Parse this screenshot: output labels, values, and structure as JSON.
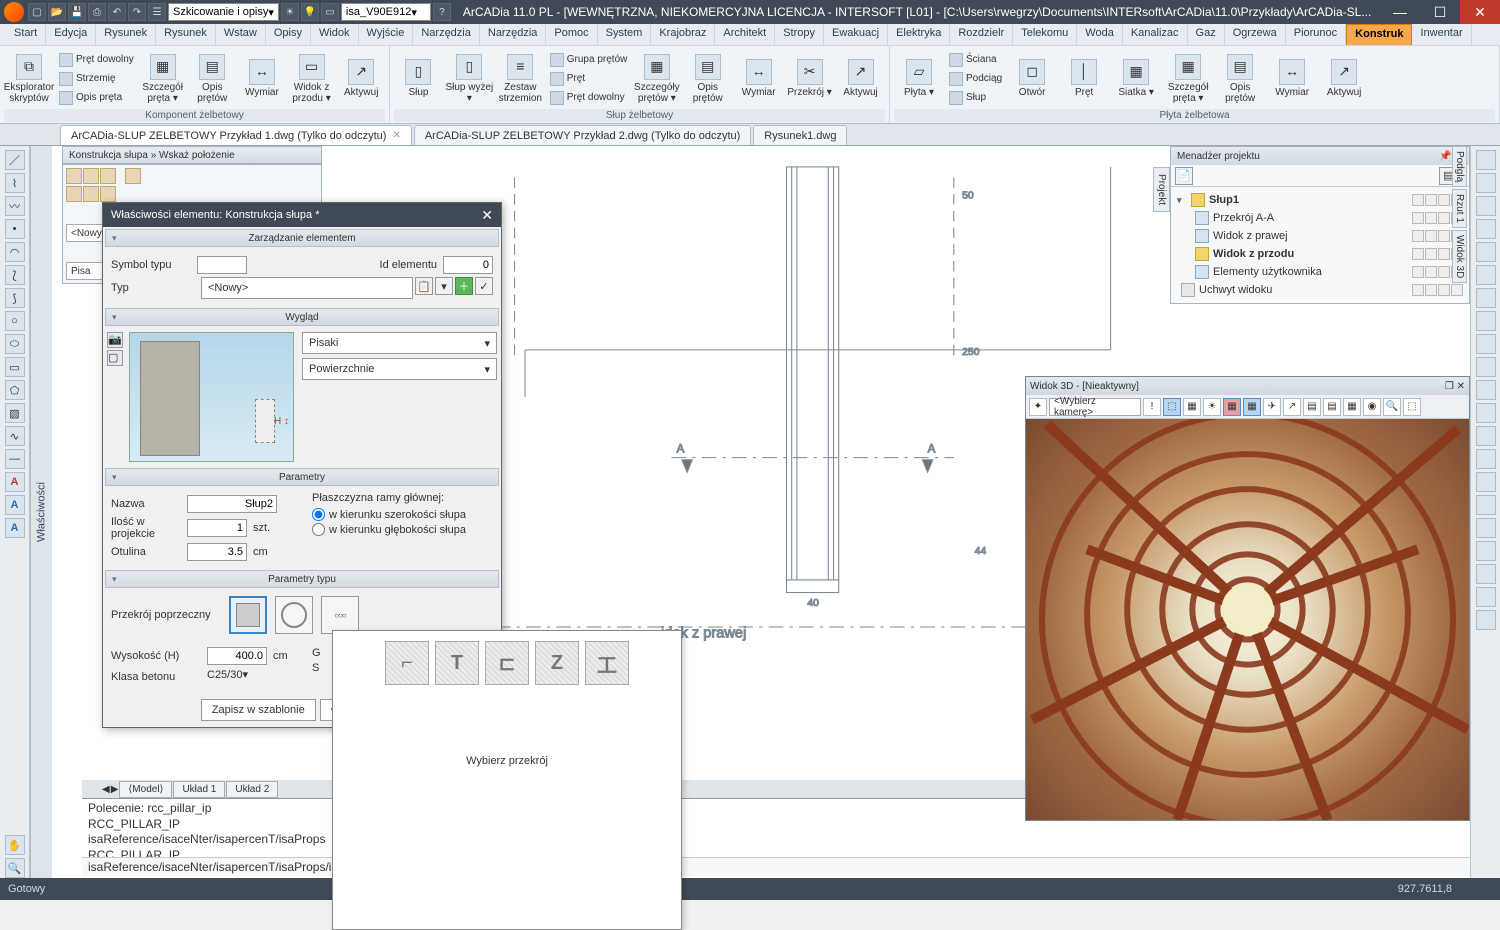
{
  "title": "ArCADia 11.0 PL - [WEWNĘTRZNA, NIEKOMERCYJNA LICENCJA - INTERSOFT [L01] - [C:\\Users\\rwegrzy\\Documents\\INTERsoft\\ArCADia\\11.0\\Przykłady\\ArCADia-SL...",
  "qat_combo1": "Szkicowanie i opisy",
  "qat_combo2": "isa_V90E912",
  "ribbon_tabs": [
    "Start",
    "Edycja",
    "Rysunek",
    "Rysunek",
    "Wstaw",
    "Opisy",
    "Widok",
    "Wyjście",
    "Narzędzia",
    "Narzędzia",
    "Pomoc",
    "System",
    "Krajobraz",
    "Architekt",
    "Stropy",
    "Ewakuacj",
    "Elektryka",
    "Rozdzielr",
    "Telekomu",
    "Woda",
    "Kanalizac",
    "Gaz",
    "Ogrzewa",
    "Piorunoc",
    "Konstruk",
    "Inwentar"
  ],
  "ribbon_active": "Konstruk",
  "panels": {
    "p1": {
      "label": "Komponent żelbetowy",
      "items": [
        "Pręt dowolny",
        "Strzemię",
        "Opis pręta"
      ],
      "big": [
        {
          "l": "Eksplorator\nskryptów"
        },
        {
          "l": "Szczegół\npręta ▾"
        },
        {
          "l": "Opis\nprętów"
        },
        {
          "l": "Wymiar"
        },
        {
          "l": "Widok z\nprzodu ▾"
        },
        {
          "l": "Aktywuj"
        }
      ]
    },
    "p2": {
      "label": "Słup żelbetowy",
      "items": [
        "Grupa prętów",
        "Pręt",
        "Pręt dowolny"
      ],
      "big": [
        {
          "l": "Słup"
        },
        {
          "l": "Słup\nwyżej ▾"
        },
        {
          "l": "Zestaw\nstrzemion"
        },
        {
          "l": "Szczegóły\nprętów ▾"
        },
        {
          "l": "Opis\nprętów"
        },
        {
          "l": "Wymiar"
        },
        {
          "l": "Przekrój\n▾"
        },
        {
          "l": "Aktywuj"
        }
      ]
    },
    "p3": {
      "label": "Płyta żelbetowa",
      "items": [
        "Ściana",
        "Podciąg",
        "Słup"
      ],
      "big": [
        {
          "l": "Płyta\n▾"
        },
        {
          "l": "Otwór"
        },
        {
          "l": "Pręt"
        },
        {
          "l": "Siatka\n▾"
        },
        {
          "l": "Szczegół\npręta ▾"
        },
        {
          "l": "Opis\nprętów"
        },
        {
          "l": "Wymiar"
        },
        {
          "l": "Aktywuj"
        }
      ]
    }
  },
  "doctabs": [
    {
      "label": "ArCADia-SLUP ZELBETOWY Przykład 1.dwg (Tylko do odczytu)",
      "active": true,
      "closable": true
    },
    {
      "label": "ArCADia-SLUP ZELBETOWY Przykład 2.dwg (Tylko do odczytu)",
      "active": false,
      "closable": false
    },
    {
      "label": "Rysunek1.dwg",
      "active": false,
      "closable": false
    }
  ],
  "props_handle": "Właściwości",
  "constr_head": "Konstrukcja słupa » Wskaż położenie",
  "constr_sel1": "<Nowy>",
  "constr_sel2": "Pisa",
  "dialog": {
    "title": "Właściwości elementu: Konstrukcja słupa *",
    "sec1": "Zarządzanie elementem",
    "symbol_l": "Symbol typu",
    "symbol_v": "",
    "id_l": "Id elementu",
    "id_v": "0",
    "typ_l": "Typ",
    "typ_v": "<Nowy>",
    "sec2": "Wygląd",
    "dd1": "Pisaki",
    "dd2": "Powierzchnie",
    "sec3": "Parametry",
    "nazwa_l": "Nazwa",
    "nazwa_v": "Słup2",
    "ilosc_l": "Ilość w projekcie",
    "ilosc_v": "1",
    "ilosc_u": "szt.",
    "otulina_l": "Otulina",
    "otulina_v": "3.5",
    "otulina_u": "cm",
    "plasz_l": "Płaszczyzna ramy głównej:",
    "rad1": "w kierunku szerokości słupa",
    "rad2": "w kierunku głębokości słupa",
    "sec4": "Parametry typu",
    "przek_l": "Przekrój poprzeczny",
    "wys_l": "Wysokość (H)",
    "wys_v": "400.0",
    "wys_u": "cm",
    "klasa_l": "Klasa betonu",
    "klasa_v": "C25/30",
    "zapisz": "Zapisz w szablonie",
    "g_l": "G",
    "s_l": "S"
  },
  "xsec": {
    "label": "Wybierz przekrój"
  },
  "proj_mgr": {
    "title": "Menadżer projektu",
    "tab": "Projekt",
    "tree": [
      {
        "l": "Słup1",
        "d": 0,
        "bold": true,
        "exp": "▾"
      },
      {
        "l": "Przekrój A-A",
        "d": 1
      },
      {
        "l": "Widok z prawej",
        "d": 1
      },
      {
        "l": "Widok z przodu",
        "d": 1,
        "bold": true
      },
      {
        "l": "Elementy użytkownika",
        "d": 1
      },
      {
        "l": "Uchwyt widoku",
        "d": 1
      }
    ]
  },
  "view3d": {
    "title": "Widok 3D - [Nieaktywny]",
    "camera": "<Wybierz kamerę>"
  },
  "right_handles": [
    "Podglą",
    "Rzut 1",
    "Widok 3D"
  ],
  "cmd": {
    "lines": [
      "Polecenie: rcc_pillar_ip",
      "RCC_PILLAR_IP",
      "isaReference/isaceNter/isapercenT/isaProps",
      "RCC_PILLAR_IP"
    ],
    "input": "isaReference/isaceNter/isapercenT/isaProps/isare"
  },
  "model_tabs": [
    "⟨Model⟩",
    "Układ 1",
    "Układ 2"
  ],
  "status": {
    "left": "Gotowy",
    "coord": "927.7611,8"
  },
  "drawing_label": "idok z prawej",
  "dims": {
    "d250l": "250",
    "d250r": "250",
    "d50": "50",
    "d44l": "44",
    "d44r": "44",
    "d40": "40",
    "aL": "A",
    "aR": "A"
  }
}
